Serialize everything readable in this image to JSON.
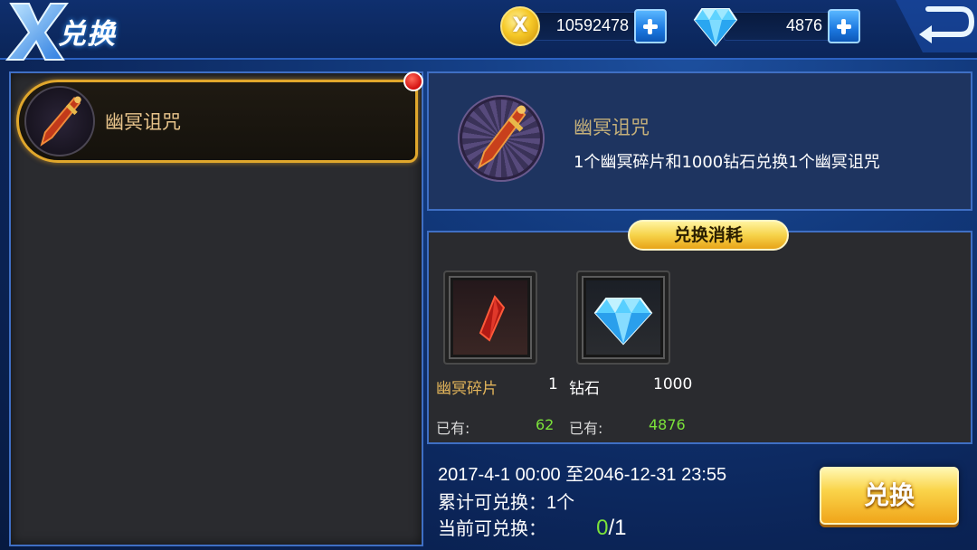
{
  "header": {
    "title": "兑换",
    "gold_amount": "10592478",
    "diamond_amount": "4876",
    "coin_glyph": "X"
  },
  "item_list": [
    {
      "name": "幽冥诅咒",
      "selected": true,
      "has_notification": true
    }
  ],
  "detail": {
    "name": "幽冥诅咒",
    "description": "1个幽冥碎片和1000钻石兑换1个幽冥诅咒"
  },
  "cost": {
    "title": "兑换消耗",
    "items": [
      {
        "name": "幽冥碎片",
        "required": "1",
        "have_label": "已有:",
        "have": "62",
        "icon": "red-crystal-shard-icon"
      },
      {
        "name": "钻石",
        "required": "1000",
        "have_label": "已有:",
        "have": "4876",
        "icon": "diamond-icon"
      }
    ]
  },
  "info": {
    "period": "2017-4-1 00:00 至2046-12-31 23:55",
    "total_label": "累计可兑换：1个",
    "current_label": "当前可兑换：",
    "current_count": "0",
    "current_max": "/1"
  },
  "exchange_button": "兑换",
  "colors": {
    "accent_gold": "#e0a72c",
    "have_green": "#7be23a",
    "panel_border": "#3f6fc4"
  }
}
